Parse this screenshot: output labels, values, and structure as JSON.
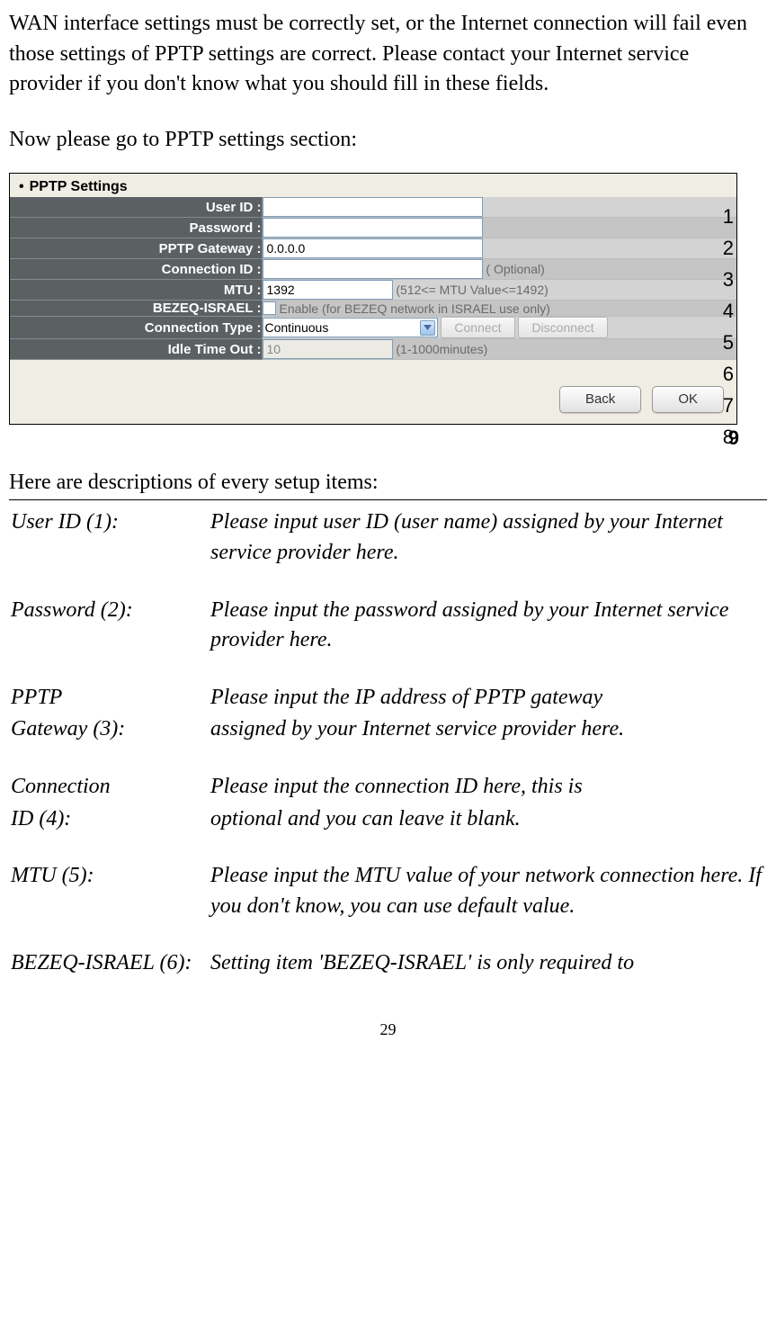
{
  "intro": "WAN interface settings must be correctly set, or the Internet connection will fail even those settings of PPTP settings are correct. Please contact your Internet service provider if you don't know what you should fill in these fields.",
  "lead": "Now please go to PPTP settings section:",
  "section_title": "PPTP Settings",
  "rows": {
    "user_id": {
      "label": "User ID :",
      "value": ""
    },
    "password": {
      "label": "Password :",
      "value": ""
    },
    "gateway": {
      "label": "PPTP Gateway :",
      "value": "0.0.0.0"
    },
    "conn_id": {
      "label": "Connection ID :",
      "value": "",
      "hint": "( Optional)"
    },
    "mtu": {
      "label": "MTU :",
      "value": "1392",
      "hint": "(512<= MTU Value<=1492)"
    },
    "bezeq": {
      "label": "BEZEQ-ISRAEL :",
      "hint": "Enable (for BEZEQ network in ISRAEL use only)"
    },
    "conn_type": {
      "label": "Connection Type :",
      "selected": "Continuous",
      "connect": "Connect",
      "disconnect": "Disconnect"
    },
    "idle": {
      "label": "Idle Time Out :",
      "value": "10",
      "hint": "(1-1000minutes)"
    }
  },
  "buttons": {
    "back": "Back",
    "ok": "OK"
  },
  "callouts": [
    "1",
    "2",
    "3",
    "4",
    "5",
    "6",
    "7",
    "8",
    "9"
  ],
  "desc_lead": "Here are descriptions of every setup items:",
  "desc": {
    "userid": {
      "label": "User ID (1):",
      "text": "Please input user ID (user name) assigned by your Internet service provider here."
    },
    "password": {
      "label": "Password (2):",
      "text": "Please input the password assigned by your Internet service provider here."
    },
    "gateway": {
      "label1": "PPTP",
      "label2": "Gateway (3):",
      "text1": "Please input the IP address of PPTP gateway",
      "text2": "assigned by your Internet service provider here."
    },
    "connid": {
      "label1": "Connection",
      "label2": "ID (4):",
      "text1": "Please input the connection ID here, this is",
      "text2": "optional and you can leave it blank."
    },
    "mtu": {
      "label": "MTU (5):",
      "text": "Please input the MTU value of your network connection here. If you don't know, you can use default value."
    },
    "bezeq": {
      "label": "BEZEQ-ISRAEL (6):",
      "text": "Setting item 'BEZEQ-ISRAEL' is only required to"
    }
  },
  "page_num": "29"
}
